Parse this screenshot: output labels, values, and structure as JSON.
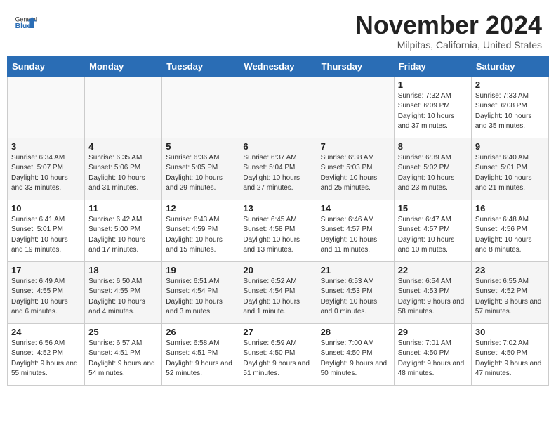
{
  "header": {
    "logo_line1": "General",
    "logo_line2": "Blue",
    "month": "November 2024",
    "location": "Milpitas, California, United States"
  },
  "days_of_week": [
    "Sunday",
    "Monday",
    "Tuesday",
    "Wednesday",
    "Thursday",
    "Friday",
    "Saturday"
  ],
  "weeks": [
    [
      {
        "day": "",
        "info": ""
      },
      {
        "day": "",
        "info": ""
      },
      {
        "day": "",
        "info": ""
      },
      {
        "day": "",
        "info": ""
      },
      {
        "day": "",
        "info": ""
      },
      {
        "day": "1",
        "info": "Sunrise: 7:32 AM\nSunset: 6:09 PM\nDaylight: 10 hours and 37 minutes."
      },
      {
        "day": "2",
        "info": "Sunrise: 7:33 AM\nSunset: 6:08 PM\nDaylight: 10 hours and 35 minutes."
      }
    ],
    [
      {
        "day": "3",
        "info": "Sunrise: 6:34 AM\nSunset: 5:07 PM\nDaylight: 10 hours and 33 minutes."
      },
      {
        "day": "4",
        "info": "Sunrise: 6:35 AM\nSunset: 5:06 PM\nDaylight: 10 hours and 31 minutes."
      },
      {
        "day": "5",
        "info": "Sunrise: 6:36 AM\nSunset: 5:05 PM\nDaylight: 10 hours and 29 minutes."
      },
      {
        "day": "6",
        "info": "Sunrise: 6:37 AM\nSunset: 5:04 PM\nDaylight: 10 hours and 27 minutes."
      },
      {
        "day": "7",
        "info": "Sunrise: 6:38 AM\nSunset: 5:03 PM\nDaylight: 10 hours and 25 minutes."
      },
      {
        "day": "8",
        "info": "Sunrise: 6:39 AM\nSunset: 5:02 PM\nDaylight: 10 hours and 23 minutes."
      },
      {
        "day": "9",
        "info": "Sunrise: 6:40 AM\nSunset: 5:01 PM\nDaylight: 10 hours and 21 minutes."
      }
    ],
    [
      {
        "day": "10",
        "info": "Sunrise: 6:41 AM\nSunset: 5:01 PM\nDaylight: 10 hours and 19 minutes."
      },
      {
        "day": "11",
        "info": "Sunrise: 6:42 AM\nSunset: 5:00 PM\nDaylight: 10 hours and 17 minutes."
      },
      {
        "day": "12",
        "info": "Sunrise: 6:43 AM\nSunset: 4:59 PM\nDaylight: 10 hours and 15 minutes."
      },
      {
        "day": "13",
        "info": "Sunrise: 6:45 AM\nSunset: 4:58 PM\nDaylight: 10 hours and 13 minutes."
      },
      {
        "day": "14",
        "info": "Sunrise: 6:46 AM\nSunset: 4:57 PM\nDaylight: 10 hours and 11 minutes."
      },
      {
        "day": "15",
        "info": "Sunrise: 6:47 AM\nSunset: 4:57 PM\nDaylight: 10 hours and 10 minutes."
      },
      {
        "day": "16",
        "info": "Sunrise: 6:48 AM\nSunset: 4:56 PM\nDaylight: 10 hours and 8 minutes."
      }
    ],
    [
      {
        "day": "17",
        "info": "Sunrise: 6:49 AM\nSunset: 4:55 PM\nDaylight: 10 hours and 6 minutes."
      },
      {
        "day": "18",
        "info": "Sunrise: 6:50 AM\nSunset: 4:55 PM\nDaylight: 10 hours and 4 minutes."
      },
      {
        "day": "19",
        "info": "Sunrise: 6:51 AM\nSunset: 4:54 PM\nDaylight: 10 hours and 3 minutes."
      },
      {
        "day": "20",
        "info": "Sunrise: 6:52 AM\nSunset: 4:54 PM\nDaylight: 10 hours and 1 minute."
      },
      {
        "day": "21",
        "info": "Sunrise: 6:53 AM\nSunset: 4:53 PM\nDaylight: 10 hours and 0 minutes."
      },
      {
        "day": "22",
        "info": "Sunrise: 6:54 AM\nSunset: 4:53 PM\nDaylight: 9 hours and 58 minutes."
      },
      {
        "day": "23",
        "info": "Sunrise: 6:55 AM\nSunset: 4:52 PM\nDaylight: 9 hours and 57 minutes."
      }
    ],
    [
      {
        "day": "24",
        "info": "Sunrise: 6:56 AM\nSunset: 4:52 PM\nDaylight: 9 hours and 55 minutes."
      },
      {
        "day": "25",
        "info": "Sunrise: 6:57 AM\nSunset: 4:51 PM\nDaylight: 9 hours and 54 minutes."
      },
      {
        "day": "26",
        "info": "Sunrise: 6:58 AM\nSunset: 4:51 PM\nDaylight: 9 hours and 52 minutes."
      },
      {
        "day": "27",
        "info": "Sunrise: 6:59 AM\nSunset: 4:50 PM\nDaylight: 9 hours and 51 minutes."
      },
      {
        "day": "28",
        "info": "Sunrise: 7:00 AM\nSunset: 4:50 PM\nDaylight: 9 hours and 50 minutes."
      },
      {
        "day": "29",
        "info": "Sunrise: 7:01 AM\nSunset: 4:50 PM\nDaylight: 9 hours and 48 minutes."
      },
      {
        "day": "30",
        "info": "Sunrise: 7:02 AM\nSunset: 4:50 PM\nDaylight: 9 hours and 47 minutes."
      }
    ]
  ]
}
